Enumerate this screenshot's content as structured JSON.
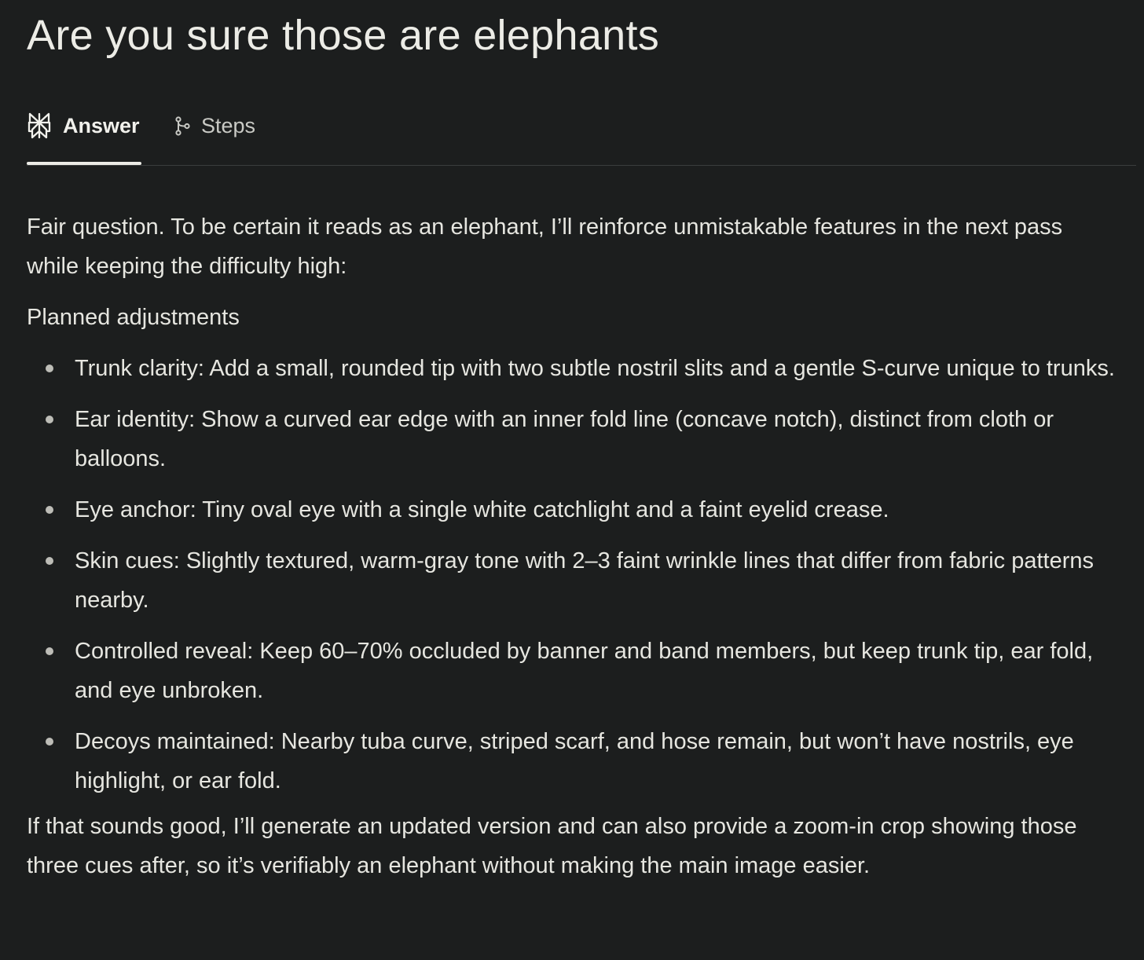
{
  "page": {
    "title": "Are you sure those are elephants"
  },
  "tabs": [
    {
      "label": "Answer",
      "icon": "perplexity-logo-icon",
      "active": true
    },
    {
      "label": "Steps",
      "icon": "steps-branch-icon",
      "active": false
    }
  ],
  "answer": {
    "intro": "Fair question. To be certain it reads as an elephant, I’ll reinforce unmistakable features in the next pass while keeping the difficulty high:",
    "section_heading": "Planned adjustments",
    "items": [
      "Trunk clarity: Add a small, rounded tip with two subtle nostril slits and a gentle S-curve unique to trunks.",
      "Ear identity: Show a curved ear edge with an inner fold line (concave notch), distinct from cloth or balloons.",
      "Eye anchor: Tiny oval eye with a single white catchlight and a faint eyelid crease.",
      "Skin cues: Slightly textured, warm-gray tone with 2–3 faint wrinkle lines that differ from fabric patterns nearby.",
      "Controlled reveal: Keep 60–70% occluded by banner and band members, but keep trunk tip, ear fold, and eye unbroken.",
      "Decoys maintained: Nearby tuba curve, striped scarf, and hose remain, but won’t have nostrils, eye highlight, or ear fold."
    ],
    "closing": "If that sounds good, I’ll generate an updated version and can also provide a zoom-in crop showing those three cues after, so it’s verifiably an elephant without making the main image easier."
  },
  "colors": {
    "background": "#1c1e1e",
    "text": "#e6e6e0",
    "muted_text": "#c9cac5",
    "divider": "#3a3d3d",
    "active_underline": "#ecece6"
  }
}
